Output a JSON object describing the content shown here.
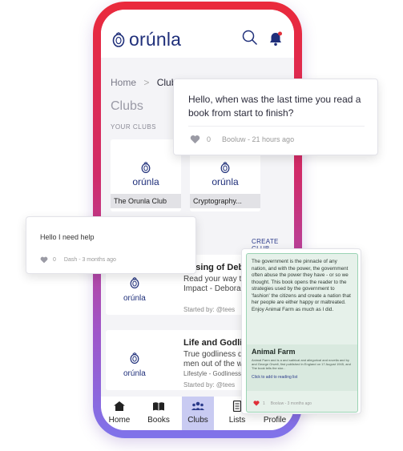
{
  "app": {
    "name": "orúnla",
    "brand_color": "#1f2f7a",
    "accent": "#c9cbf2"
  },
  "breadcrumb": {
    "home": "Home",
    "separator": ">",
    "current": "Clubs"
  },
  "page_title": "Clubs",
  "section_label": "YOUR CLUBS",
  "create_club": "CREATE CLUB",
  "your_clubs": [
    {
      "logo": "orúnla",
      "name": "The Orunla Club"
    },
    {
      "logo": "orúnla",
      "name": "Cryptography..."
    }
  ],
  "club_list": [
    {
      "logo": "orúnla",
      "title": "...lising of Deb",
      "desc": "Read your way to ex\nImpact - Deborahs -...",
      "by": "Started by: @tees"
    },
    {
      "logo": "orúnla",
      "title": "Life and Godlines",
      "desc": "True godliness does\nmen out of the world",
      "meta": "Lifestyle - Godliness - Ef",
      "by": "Started by: @tees"
    }
  ],
  "nav": [
    {
      "label": "Home",
      "icon": "home-icon"
    },
    {
      "label": "Books",
      "icon": "books-icon"
    },
    {
      "label": "Clubs",
      "icon": "clubs-icon",
      "active": true
    },
    {
      "label": "Lists",
      "icon": "lists-icon",
      "badge": true
    },
    {
      "label": "Profile",
      "icon": "profile-icon"
    }
  ],
  "question_card": {
    "text": "Hello, when was the last time you read a book from start to finish?",
    "likes": "0",
    "meta": "Booluw - 21 hours ago"
  },
  "help_card": {
    "text": "Hello I need help",
    "likes": "0",
    "meta": "Dash - 3 months ago"
  },
  "book_card": {
    "quote": "The government is the pinnacle of any nation, and with the power, the government often abuse the power they have - or so we thought. This book opens the reader to the strategies used by the government to 'fashion' the citizens and create a nation that her people are either happy or maltreated. Enjoy Animal Farm as much as I did.",
    "title": "Animal Farm",
    "desc": "Animal Farm and is a and satirical and allegorical and novella and by and George Orwell, first published in England on 17 August 1945, and The book tells the stor...",
    "add_label": "Click to add to reading list",
    "likes": "1",
    "meta": "Booluw - 3 months ago",
    "heart_color": "#e0303a"
  }
}
